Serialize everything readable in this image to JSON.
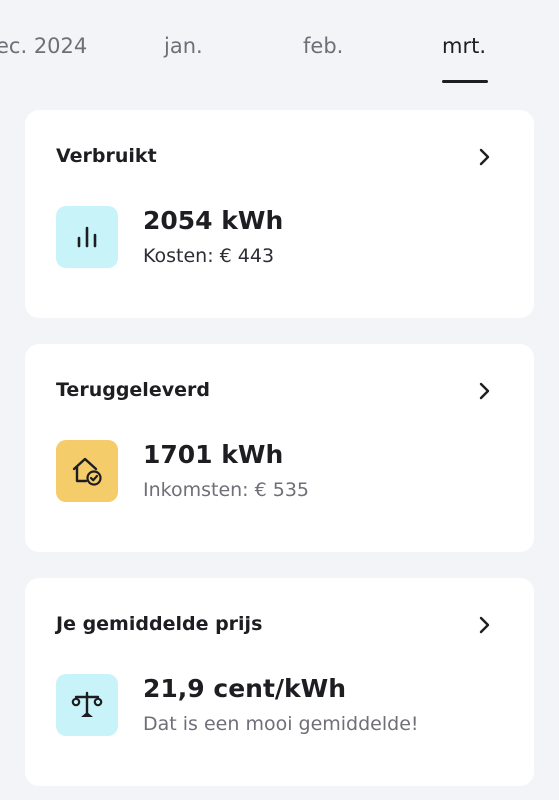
{
  "months": {
    "items": [
      "ec. 2024",
      "jan.",
      "feb.",
      "mrt."
    ],
    "active_index": 3
  },
  "cards": [
    {
      "title": "Verbruikt",
      "value": "2054 kWh",
      "sub": "Kosten: € 443",
      "icon": "bar-chart-icon",
      "icon_bg": "#c8f4f9"
    },
    {
      "title": "Teruggeleverd",
      "value": "1701 kWh",
      "sub": "Inkomsten: € 535",
      "icon": "house-check-icon",
      "icon_bg": "#f4cc6a"
    },
    {
      "title": "Je gemiddelde prijs",
      "value": "21,9 cent/kWh",
      "sub": "Dat is een mooi gemiddelde!",
      "icon": "scale-icon",
      "icon_bg": "#c8f4f9"
    }
  ]
}
